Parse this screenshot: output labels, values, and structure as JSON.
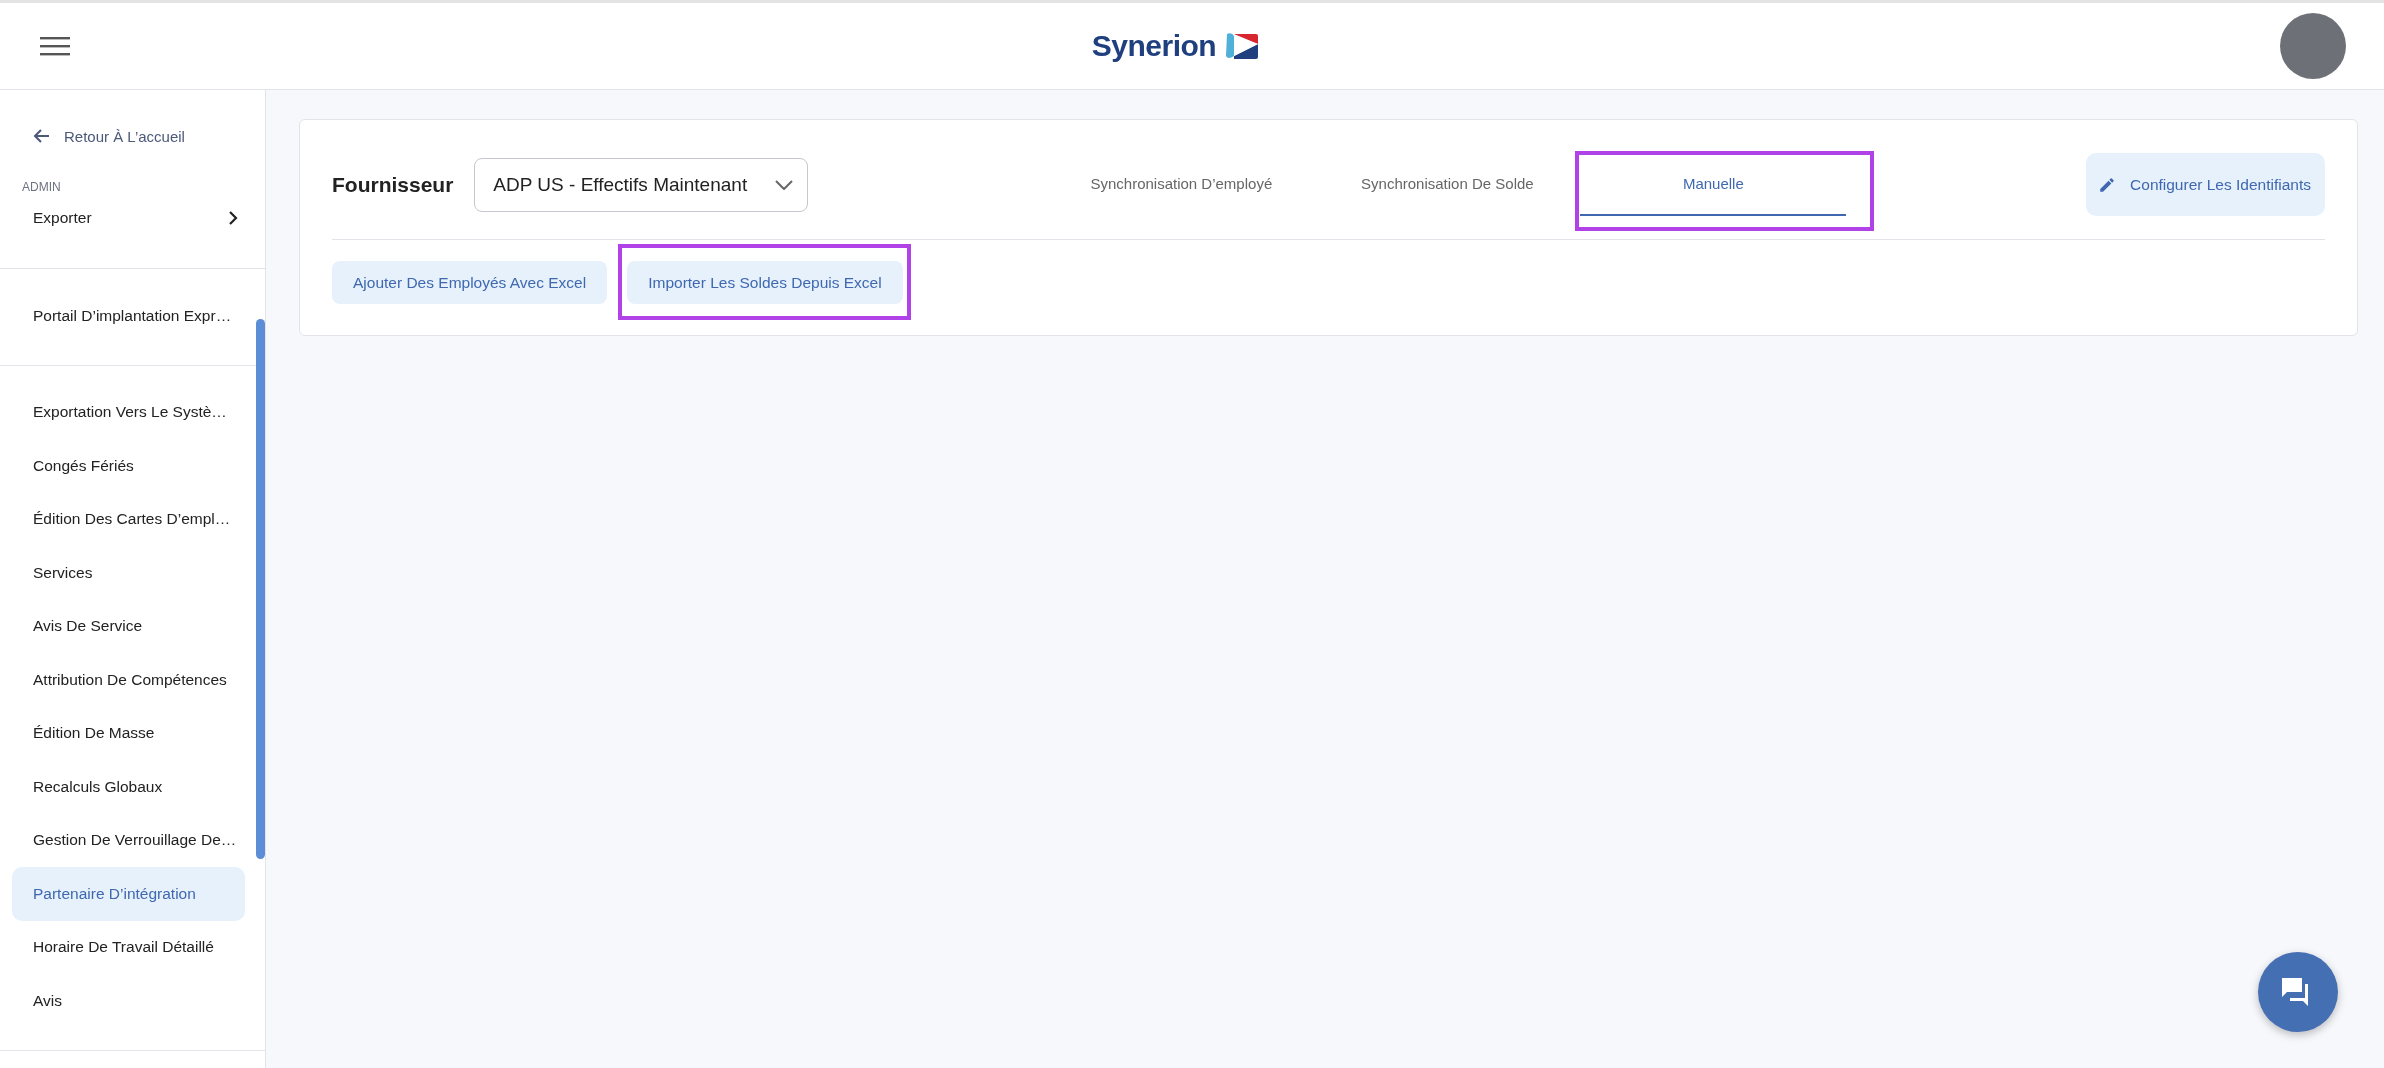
{
  "header": {
    "logo_text": "Synerion"
  },
  "sidebar": {
    "back_link": "Retour À L’accueil",
    "section_label": "ADMIN",
    "groups": [
      {
        "items": [
          {
            "label": "Exporter",
            "kind": "submenu",
            "selected": false
          }
        ]
      },
      {
        "items": [
          {
            "label": "Portail D’implantation Expr…",
            "kind": "link",
            "selected": false
          }
        ]
      },
      {
        "items": [
          {
            "label": "Exportation Vers Le Systè…",
            "kind": "link",
            "selected": false
          },
          {
            "label": "Congés Fériés",
            "kind": "link",
            "selected": false
          },
          {
            "label": "Édition Des Cartes D’empl…",
            "kind": "link",
            "selected": false
          },
          {
            "label": "Services",
            "kind": "link",
            "selected": false
          },
          {
            "label": "Avis De Service",
            "kind": "link",
            "selected": false
          },
          {
            "label": "Attribution De Compétences",
            "kind": "link",
            "selected": false
          },
          {
            "label": "Édition De Masse",
            "kind": "link",
            "selected": false
          },
          {
            "label": "Recalculs Globaux",
            "kind": "link",
            "selected": false
          },
          {
            "label": "Gestion De Verrouillage De…",
            "kind": "link",
            "selected": false
          },
          {
            "label": "Partenaire D’intégration",
            "kind": "link",
            "selected": true
          },
          {
            "label": "Horaire De Travail Détaillé",
            "kind": "link",
            "selected": false
          },
          {
            "label": "Avis",
            "kind": "link",
            "selected": false
          }
        ]
      }
    ]
  },
  "provider": {
    "label": "Fournisseur",
    "value": "ADP US - Effectifs Maintenant"
  },
  "tabs": [
    {
      "label": "Synchronisation D’employé",
      "selected": false,
      "highlighted": false
    },
    {
      "label": "Synchronisation De Solde",
      "selected": false,
      "highlighted": false
    },
    {
      "label": "Manuelle",
      "selected": true,
      "highlighted": true
    }
  ],
  "configure_button": "Configurer Les Identifiants",
  "actions": [
    {
      "label": "Ajouter Des Employés Avec Excel",
      "highlighted": false
    },
    {
      "label": "Importer Les Soldes Depuis Excel",
      "highlighted": true
    }
  ]
}
